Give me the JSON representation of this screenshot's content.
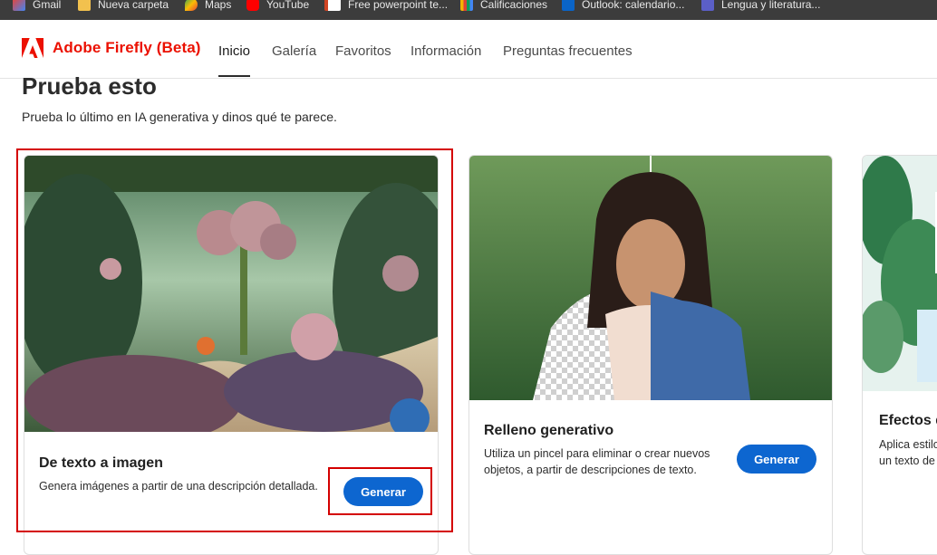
{
  "bookmarks": [
    {
      "label": "Gmail",
      "icon": "gmail-icon"
    },
    {
      "label": "Nueva carpeta",
      "icon": "folder-icon"
    },
    {
      "label": "Maps",
      "icon": "maps-icon"
    },
    {
      "label": "YouTube",
      "icon": "youtube-icon"
    },
    {
      "label": "Free powerpoint te...",
      "icon": "powerpoint-icon"
    },
    {
      "label": "Calificaciones",
      "icon": "chart-icon"
    },
    {
      "label": "Outlook: calendario...",
      "icon": "outlook-icon"
    },
    {
      "label": "Lengua y literatura...",
      "icon": "teams-icon"
    }
  ],
  "brand": {
    "name": "Adobe Firefly (Beta)",
    "color": "#eb1000"
  },
  "nav": {
    "items": [
      "Inicio",
      "Galería",
      "Favoritos",
      "Información",
      "Preguntas frecuentes"
    ],
    "active": "Inicio"
  },
  "section": {
    "title": "Prueba esto",
    "subtitle": "Prueba lo último en IA generativa y dinos qué te parece."
  },
  "cards": [
    {
      "title": "De texto a imagen",
      "description": "Genera imágenes a partir de una descripción detallada.",
      "button": "Generar"
    },
    {
      "title": "Relleno generativo",
      "description_line1": "Utiliza un pincel para eliminar o crear nuevos",
      "description_line2": "objetos, a partir de descripciones de texto.",
      "button": "Generar"
    },
    {
      "title": "Efectos d",
      "description_line1": "Aplica estilo",
      "description_line2": "un texto de"
    }
  ],
  "colors": {
    "accent": "#0d66d0",
    "highlight": "#d40000"
  }
}
